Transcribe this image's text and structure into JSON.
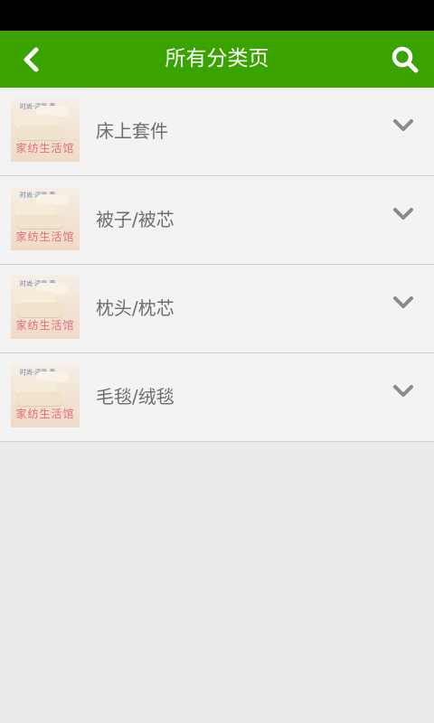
{
  "header": {
    "title": "所有分类页",
    "back_icon": "back-arrow-icon",
    "search_icon": "search-icon",
    "accent_color": "#3aa300"
  },
  "thumbnail": {
    "banner_text": "家纺生活馆",
    "tag_text": "时尚·温暖·春"
  },
  "categories": [
    {
      "label": "床上套件"
    },
    {
      "label": "被子/被芯"
    },
    {
      "label": "枕头/枕芯"
    },
    {
      "label": "毛毯/绒毯"
    }
  ]
}
